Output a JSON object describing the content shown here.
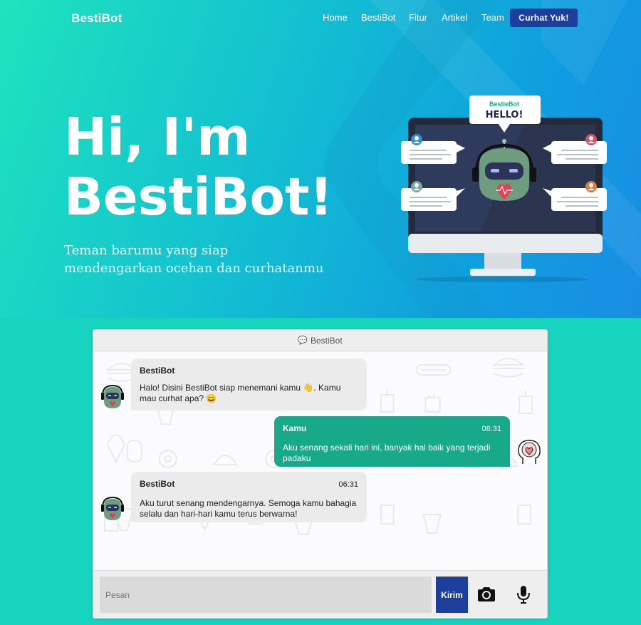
{
  "nav": {
    "brand": "BestiBot",
    "links": [
      "Home",
      "BestiBot",
      "Fitur",
      "Artikel",
      "Team"
    ],
    "cta": "Curhat Yuk!"
  },
  "hero": {
    "title_line1": "Hi, I'm",
    "title_line2": "BestiBot!",
    "subtitle_line1": "Teman barumu yang siap",
    "subtitle_line2": "mendengarkan ocehan dan curhatanmu",
    "speech_brand": "BestieBot",
    "speech_text": "HELLO!"
  },
  "chat": {
    "header": "BestiBot",
    "header_icon": "speech-bubble-icon",
    "messages": [
      {
        "sender": "BestiBot",
        "time": "",
        "text": "Halo! Disini BestiBot siap menemani kamu 👋. Kamu mau curhat apa? 😄",
        "side": "left"
      },
      {
        "sender": "Kamu",
        "time": "06:31",
        "text": "Aku senang sekali hari ini, banyak hal baik yang terjadi padaku",
        "side": "right"
      },
      {
        "sender": "BestiBot",
        "time": "06:31",
        "text": "Aku turut senang mendengarnya. Semoga kamu bahagia selalu dan hari-hari kamu terus berwarna!",
        "side": "left"
      }
    ],
    "input_placeholder": "Pesan",
    "send_label": "Kirim",
    "camera_icon": "camera-icon",
    "mic_icon": "microphone-icon"
  },
  "colors": {
    "primary": "#1d3f9c",
    "user_bubble": "#17a98a",
    "bot_bubble": "#ebebeb",
    "page_bg": "#16d4bd"
  }
}
